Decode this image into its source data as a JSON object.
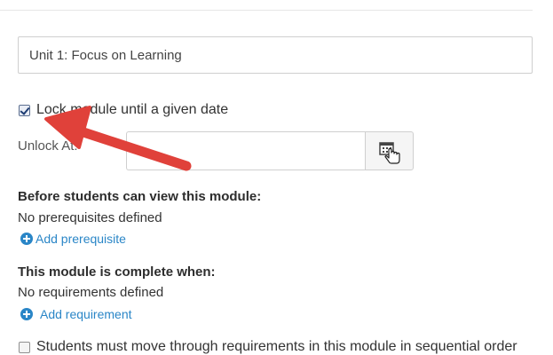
{
  "module": {
    "name_value": "Unit 1: Focus on Learning"
  },
  "lock": {
    "checked": true,
    "label": "Lock module until a given date",
    "unlock_at_label": "Unlock At:",
    "unlock_at_value": ""
  },
  "prerequisites": {
    "heading": "Before students can view this module:",
    "empty_text": "No prerequisites defined",
    "add_link": "Add prerequisite"
  },
  "requirements": {
    "heading": "This module is complete when:",
    "empty_text": "No requirements defined",
    "add_link": "Add requirement"
  },
  "sequential": {
    "checked": false,
    "label": "Students must move through requirements in this module in sequential order"
  },
  "icons": {
    "calendar_button": "calendar-icon",
    "cursor": "hand-pointer-icon",
    "add": "plus-circle-icon",
    "annotation": "red-arrow-icon"
  },
  "colors": {
    "link": "#2a86c7",
    "annotation_arrow": "#e0413a"
  }
}
